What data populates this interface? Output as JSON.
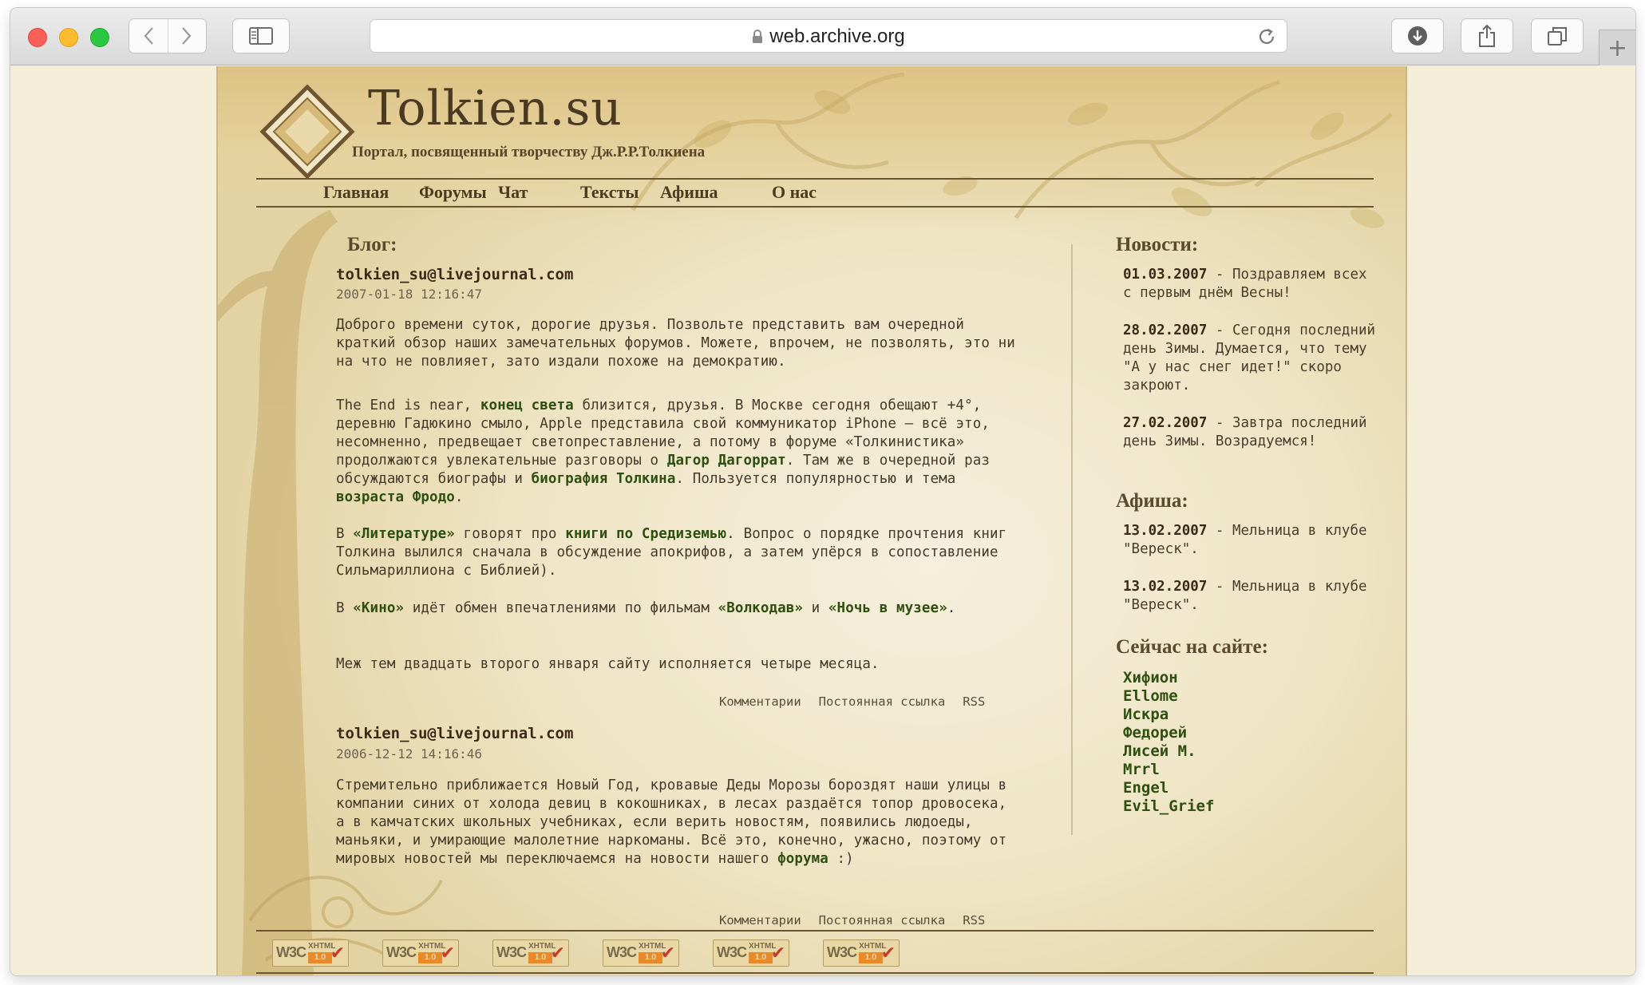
{
  "browser": {
    "url": "web.archive.org"
  },
  "site": {
    "title": "Tolkien.su",
    "subtitle": "Портал, посвященный творчеству Дж.Р.Р.Толкиена",
    "nav": [
      "Главная",
      "Форумы",
      "Чат",
      "Тексты",
      "Афиша",
      "О нас"
    ]
  },
  "blog": {
    "heading": "Блог:",
    "comments_label": "Комментарии",
    "permalink_label": "Постоянная ссылка",
    "rss_label": "RSS",
    "posts": [
      {
        "author": "tolkien_su@livejournal.com",
        "date": "2007-01-18 12:16:47",
        "p1": "Доброго времени суток, дорогие друзья. Позвольте представить вам очередной краткий обзор наших замечательных форумов. Можете, впрочем, не позволять, это ни на что не повлияет, зато издали похоже на демократию.",
        "p2a": "The End is near, ",
        "p2_link1": "конец света",
        "p2b": " близится, друзья. В Москве сегодня обещают +4°, деревню Гадюкино смыло, Apple представила свой коммуникатор iPhone — всё это, несомненно, предвещает светопреставление, а потому в форуме «Толкинистика» продолжаются увлекательные разговоры о ",
        "p2_link2": "Дагор Дагоррат",
        "p2c": ". Там же в очередной раз обсуждаются биографы и ",
        "p2_link3": "биография Толкина",
        "p2d": ". Пользуется популярностью и тема ",
        "p2_link4": "возраста Фродо",
        "p2e": ".",
        "p3a": "В ",
        "p3_link1": "«Литературе»",
        "p3b": " говорят про ",
        "p3_link2": "книги по Средиземью",
        "p3c": ". Вопрос о порядке прочтения книг Толкина вылился сначала в обсуждение апокрифов, а затем упёрся в сопоставление Сильмариллиона с Библией).",
        "p4a": "В ",
        "p4_link1": "«Кино»",
        "p4b": " идёт обмен впечатлениями по фильмам ",
        "p4_link2": "«Волкодав»",
        "p4c": " и ",
        "p4_link3": "«Ночь в музее»",
        "p4d": ".",
        "p5": "Меж тем двадцать второго января сайту исполняется четыре месяца."
      },
      {
        "author": "tolkien_su@livejournal.com",
        "date": "2006-12-12 14:16:46",
        "p1a": "Стремительно приближается Новый Год, кровавые Деды Морозы бороздят наши улицы в компании синих от холода девиц в кокошниках, в лесах раздаётся топор дровосека, а в камчатских школьных учебниках, если верить новостям, появились людоеды, маньяки, и умирающие малолетние наркоманы. Всё это, конечно, ужасно, поэтому от мировых новостей мы переключаемся на новости нашего ",
        "p1_link": "форума",
        "p1b": " :)"
      }
    ]
  },
  "news": {
    "heading": "Новости:",
    "items": [
      {
        "date": "01.03.2007",
        "text": " - Поздравляем всех с первым днём Весны!"
      },
      {
        "date": "28.02.2007",
        "text": " - Сегодня последний день Зимы. Думается, что тему \"А у нас снег идет!\" скоро закроют."
      },
      {
        "date": "27.02.2007",
        "text": " - Завтра последний день Зимы. Возрадуемся!"
      }
    ]
  },
  "afisha": {
    "heading": "Афиша:",
    "items": [
      {
        "date": "13.02.2007",
        "text": " - Мельница в клубе \"Вереск\"."
      },
      {
        "date": "13.02.2007",
        "text": " - Мельница в клубе \"Вереск\"."
      }
    ]
  },
  "online": {
    "heading": "Сейчас на сайте:",
    "users": [
      "Хифион",
      "Ellome",
      "Искра",
      "Федорей",
      "Лисей М.",
      "Mrrl",
      "Engel",
      "Evil_Grief"
    ]
  },
  "footer": {
    "badge_w3c": "W3C",
    "badge_xhtml": "XHTML",
    "badge_version": "1.0",
    "badge_count": 6
  }
}
